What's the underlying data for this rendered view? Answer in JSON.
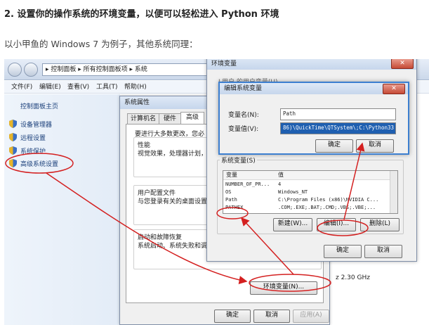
{
  "article": {
    "heading": "2. 设置你的操作系统的环境变量，以便可以轻松进入 Python 环境",
    "intro": "以小甲鱼的 Windows 7 为例子，其他系统同理："
  },
  "explorer": {
    "address": "▸ 控制面板 ▸ 所有控制面板项 ▸ 系统",
    "menu": [
      "文件(F)",
      "编辑(E)",
      "查看(V)",
      "工具(T)",
      "帮助(H)"
    ],
    "sidebar_home": "控制面板主页",
    "sidebar_items": [
      "设备管理器",
      "远程设置",
      "系统保护",
      "高级系统设置"
    ],
    "cpu_text": "z  2.30 GHz"
  },
  "sysprops": {
    "title": "系统属性",
    "tabs": [
      "计算机名",
      "硬件",
      "高级"
    ],
    "intro": "要进行大多数更改，您必",
    "perf_title": "性能",
    "perf_desc": "视觉效果，处理器计划，",
    "profile_title": "用户配置文件",
    "profile_desc": "与您登录有关的桌面设置",
    "startup_title": "启动和故障恢复",
    "startup_desc": "系统启动、系统失败和调",
    "env_button": "环境变量(N)...",
    "ok": "确定",
    "cancel": "取消",
    "apply": "应用(A)"
  },
  "envdlg": {
    "title": "环境变量",
    "user_label_partial": "L用户 的用户变量(U)",
    "sysvars_label": "系统变量(S)",
    "col_var": "变量",
    "col_val": "值",
    "rows": [
      {
        "name": "NUMBER_OF_PR...",
        "value": "4"
      },
      {
        "name": "OS",
        "value": "Windows_NT"
      },
      {
        "name": "Path",
        "value": "C:\\Program Files (x86)\\NVIDIA C..."
      },
      {
        "name": "PATHEX",
        "value": ".COM;.EXE;.BAT;.CMD;.VBS;.VBE;..."
      }
    ],
    "new_btn": "新建(W)...",
    "edit_btn": "编辑(I)...",
    "delete_btn": "删除(L)",
    "ok": "确定",
    "cancel": "取消"
  },
  "editdlg": {
    "title": "编辑系统变量",
    "name_label": "变量名(N):",
    "name_value": "Path",
    "value_label": "变量值(V):",
    "value_value": "86)\\QuickTime\\QTSystem\\;C:\\Python33",
    "ok": "确定",
    "cancel": "取消"
  },
  "colors": {
    "annotation_red": "#d42020",
    "link_blue": "#1a3f7a",
    "focus_blue": "#3c7fd0"
  }
}
